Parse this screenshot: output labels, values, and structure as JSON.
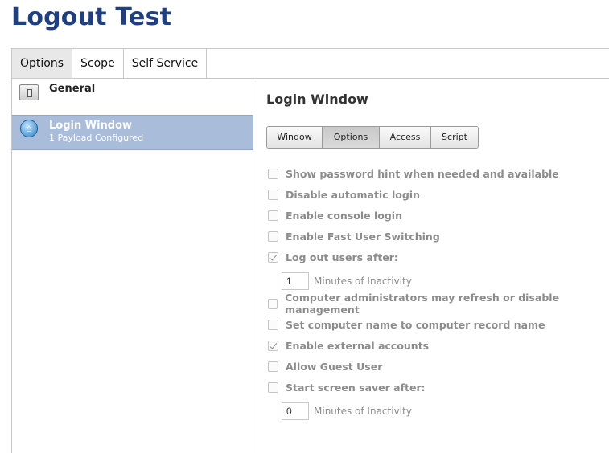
{
  "page": {
    "title": "Logout Test"
  },
  "top_tabs": [
    {
      "label": "Options",
      "active": true
    },
    {
      "label": "Scope",
      "active": false
    },
    {
      "label": "Self Service",
      "active": false
    }
  ],
  "sidebar": {
    "items": [
      {
        "label": "General",
        "icon": "switch-icon"
      },
      {
        "label": "Login Window",
        "sub": "1 Payload Configured",
        "icon": "home-icon",
        "selected": true
      }
    ]
  },
  "section": {
    "title": "Login Window",
    "subtabs": [
      {
        "label": "Window",
        "active": false
      },
      {
        "label": "Options",
        "active": true
      },
      {
        "label": "Access",
        "active": false
      },
      {
        "label": "Script",
        "active": false
      }
    ]
  },
  "options": [
    {
      "label": "Show password hint when needed and available",
      "checked": false
    },
    {
      "label": "Disable automatic login",
      "checked": false
    },
    {
      "label": "Enable console login",
      "checked": false
    },
    {
      "label": "Enable Fast User Switching",
      "checked": false
    },
    {
      "label": "Log out users after:",
      "checked": true
    },
    {
      "label": "Computer administrators may refresh or disable management",
      "checked": false
    },
    {
      "label": "Set computer name to computer record name",
      "checked": false
    },
    {
      "label": "Enable external accounts",
      "checked": true
    },
    {
      "label": "Allow Guest User",
      "checked": false
    },
    {
      "label": "Start screen saver after:",
      "checked": false
    }
  ],
  "logout_minutes": {
    "value": "1",
    "label": "Minutes of Inactivity"
  },
  "screensaver_minutes": {
    "value": "0",
    "label": "Minutes of Inactivity"
  },
  "colors": {
    "title": "#1f3f7f",
    "selected_row": "#a9bcd9",
    "disabled_text": "#8c8c8c"
  }
}
